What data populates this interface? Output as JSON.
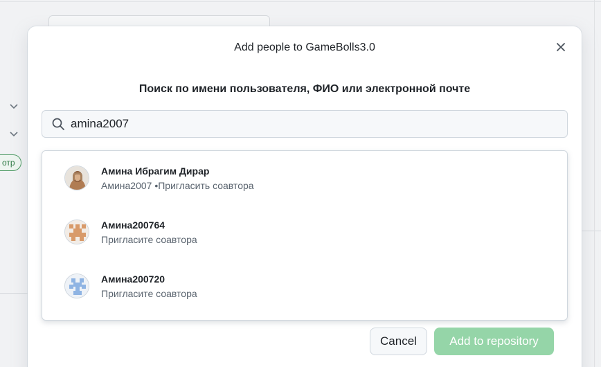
{
  "background": {
    "pill_label": "отр"
  },
  "modal": {
    "title": "Add people to GameBolls3.0",
    "close_icon": "close-icon",
    "subtitle": "Поиск по имени пользователя, ФИО или электронной почте",
    "search": {
      "icon": "search-icon",
      "value": "amina2007"
    },
    "results": [
      {
        "name": "Амина Ибрагим Дирар",
        "detail": "Амина2007 •Пригласить соавтора",
        "avatar": "photo-avatar"
      },
      {
        "name": "Амина200764",
        "detail": "Пригласите соавтора",
        "avatar": "identicon-orange"
      },
      {
        "name": "Амина200720",
        "detail": "Пригласите соавтора",
        "avatar": "identicon-blue"
      }
    ],
    "buttons": {
      "cancel": "Cancel",
      "add": "Add to repository"
    }
  },
  "colors": {
    "accent_disabled": "#95d5a8",
    "identicon_orange": "#d89a6a",
    "identicon_blue": "#8fb4e3"
  }
}
